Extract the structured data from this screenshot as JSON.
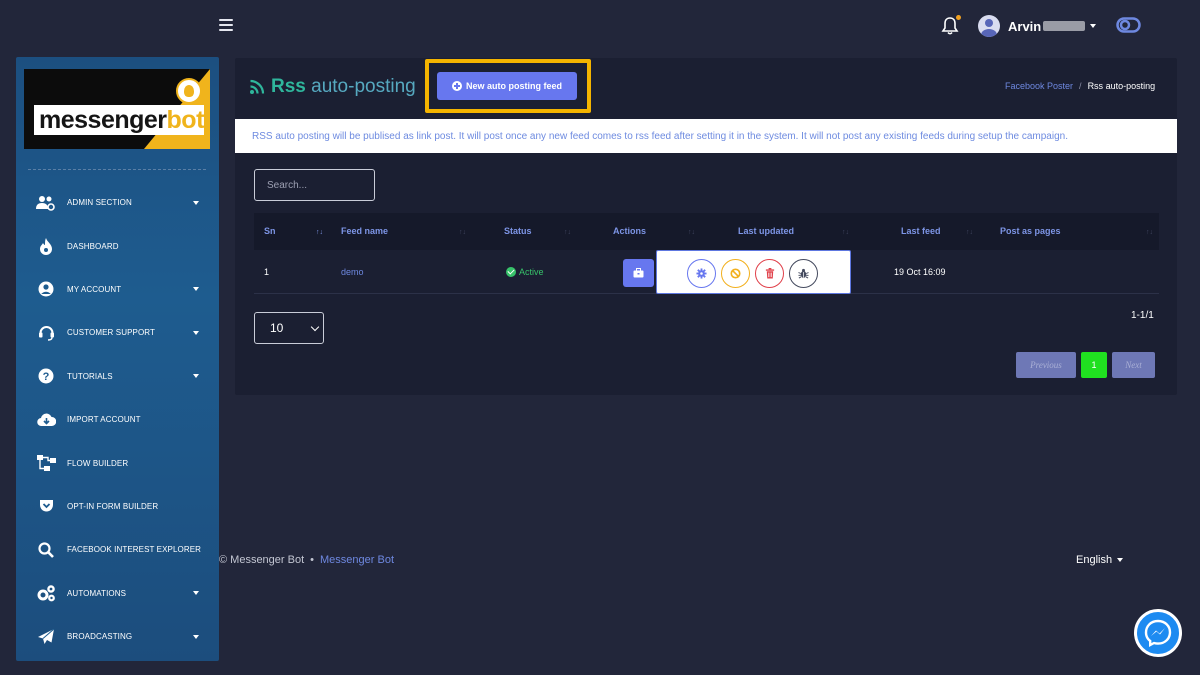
{
  "topbar": {
    "user_name": "Arvin"
  },
  "sidebar": {
    "logo_text_a": "messenger",
    "logo_text_b": "bot",
    "items": [
      {
        "label": "ADMIN SECTION",
        "icon": "users-cog-icon",
        "has_caret": true
      },
      {
        "label": "DASHBOARD",
        "icon": "fire-icon",
        "has_caret": false
      },
      {
        "label": "MY ACCOUNT",
        "icon": "user-circle-icon",
        "has_caret": true
      },
      {
        "label": "CUSTOMER SUPPORT",
        "icon": "headset-icon",
        "has_caret": true
      },
      {
        "label": "TUTORIALS",
        "icon": "question-circle-icon",
        "has_caret": true
      },
      {
        "label": "IMPORT ACCOUNT",
        "icon": "cloud-download-icon",
        "has_caret": false
      },
      {
        "label": "FLOW BUILDER",
        "icon": "sitemap-icon",
        "has_caret": false
      },
      {
        "label": "OPT-IN FORM BUILDER",
        "icon": "pocket-icon",
        "has_caret": false
      },
      {
        "label": "FACEBOOK INTEREST EXPLORER",
        "icon": "search-icon",
        "has_caret": false
      },
      {
        "label": "AUTOMATIONS",
        "icon": "cogs-icon",
        "has_caret": true
      },
      {
        "label": "BROADCASTING",
        "icon": "paper-plane-icon",
        "has_caret": true
      }
    ]
  },
  "header": {
    "title_part1": "Rss",
    "title_part2": " auto-posting",
    "new_button": "New auto posting feed",
    "breadcrumb_parent": "Facebook Poster",
    "breadcrumb_sep": "/",
    "breadcrumb_current": "Rss auto-posting"
  },
  "notice": "RSS auto posting will be publised as link post. It will post once any new feed comes to rss feed after setting it in the system. It will not post any existing feeds during setup the campaign.",
  "search": {
    "placeholder": "Search..."
  },
  "table": {
    "columns": [
      "Sn",
      "Feed name",
      "Status",
      "Actions",
      "Last updated",
      "Last feed",
      "Post as pages"
    ],
    "rows": [
      {
        "sn": "1",
        "feed_name": "demo",
        "status": "Active",
        "last_updated": "",
        "last_feed": "19 Oct 16:09",
        "post_as_pages": ""
      }
    ]
  },
  "pagination": {
    "per_page": "10",
    "info": "1-1/1",
    "previous": "Previous",
    "current": "1",
    "next": "Next"
  },
  "footer": {
    "copyright": "© Messenger Bot",
    "dot": "•",
    "link": "Messenger Bot",
    "language": "English"
  },
  "colors": {
    "accent": "#6777ef",
    "title_green": "#2fb69c",
    "highlight": "#f4b400",
    "active": "#37c26a"
  }
}
